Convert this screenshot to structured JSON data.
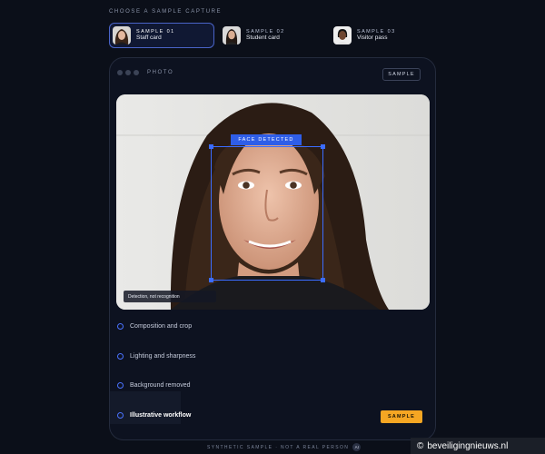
{
  "section_title": "CHOOSE A SAMPLE CAPTURE",
  "samples": [
    {
      "tag": "SAMPLE 01",
      "name": "Staff card",
      "active": true
    },
    {
      "tag": "SAMPLE 02",
      "name": "Student card",
      "active": false
    },
    {
      "tag": "SAMPLE 03",
      "name": "Visitor pass",
      "active": false
    }
  ],
  "panel": {
    "label": "PHOTO",
    "badge": "SAMPLE",
    "face_label": "FACE DETECTED",
    "caption": "Detection, not recognition"
  },
  "steps": [
    {
      "label": "Composition and crop",
      "active": false
    },
    {
      "label": "Lighting and sharpness",
      "active": false
    },
    {
      "label": "Background removed",
      "active": false
    },
    {
      "label": "Illustrative workflow",
      "active": true
    }
  ],
  "cta_label": "SAMPLE",
  "footer": {
    "text": "SYNTHETIC SAMPLE · NOT A REAL PERSON",
    "badge": "AI"
  },
  "watermark": {
    "symbol": "©",
    "text": "beveiligingnieuws.nl"
  },
  "colors": {
    "accent": "#3b6cff",
    "cta": "#f5a623",
    "background": "#0b0f19"
  },
  "icons": {
    "dots": "window-dots-icon",
    "step": "circle-outline-icon",
    "ai": "ai-badge-icon"
  }
}
